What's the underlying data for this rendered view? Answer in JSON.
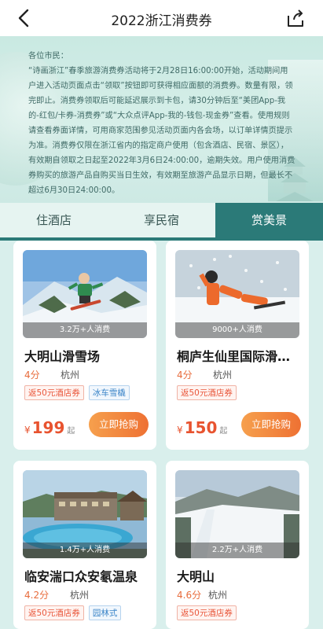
{
  "nav": {
    "title": "2022浙江消费券"
  },
  "notice": {
    "greeting": "各位市民：",
    "body": "“诗画浙江”春季旅游消费券活动将于2月28日16:00:00开始，活动期间用户进入活动页面点击“领取”按钮即可获得相应面额的消费券。数量有限，领完即止。消费券领取后可能延迟展示到卡包，请30分钟后至“美团App-我的-红包/卡券-消费券”或“大众点评App-我的-钱包-现金券”查看。使用规则请查看券面详情，可用商家范围参见活动页面内各会场，以订单详情页提示为准。消费券仅限在浙江省内的指定商户使用（包含酒店、民宿、景区），有效期自领取之日起至2022年3月6日24:00:00，逾期失效。用户使用消费券购买的旅游产品自购买当日生效，有效期至旅游产品显示日期，但最长不超过6月30日24:00:00。"
  },
  "tabs": [
    {
      "label": "住酒店",
      "active": false
    },
    {
      "label": "享民宿",
      "active": false
    },
    {
      "label": "赏美景",
      "active": true
    }
  ],
  "cards": [
    {
      "name": "大明山滑雪场",
      "rating": "4分",
      "city": "杭州",
      "consumed": "3.2万+人消费",
      "badges": [
        "返50元酒店券",
        "冰车雪橇"
      ],
      "currency": "¥",
      "price": "199",
      "price_suffix": "起",
      "buy_label": "立即抢购"
    },
    {
      "name": "桐庐生仙里国际滑雪场",
      "rating": "4分",
      "city": "杭州",
      "consumed": "9000+人消费",
      "badges": [
        "返50元酒店券"
      ],
      "currency": "¥",
      "price": "150",
      "price_suffix": "起",
      "buy_label": "立即抢购"
    },
    {
      "name": "临安湍口众安氡温泉",
      "rating": "4.2分",
      "city": "杭州",
      "consumed": "1.4万+人消费",
      "badges": [
        "返50元酒店券",
        "园林式"
      ]
    },
    {
      "name": "大明山",
      "rating": "4.6分",
      "city": "杭州",
      "consumed": "2.2万+人消费",
      "badges": [
        "返50元酒店券"
      ]
    }
  ],
  "colors": {
    "accent": "#2b7a78",
    "price": "#e8532f",
    "buy_button": "#ee7133"
  },
  "icons": {
    "back": "chevron-left-icon",
    "share": "share-icon"
  }
}
